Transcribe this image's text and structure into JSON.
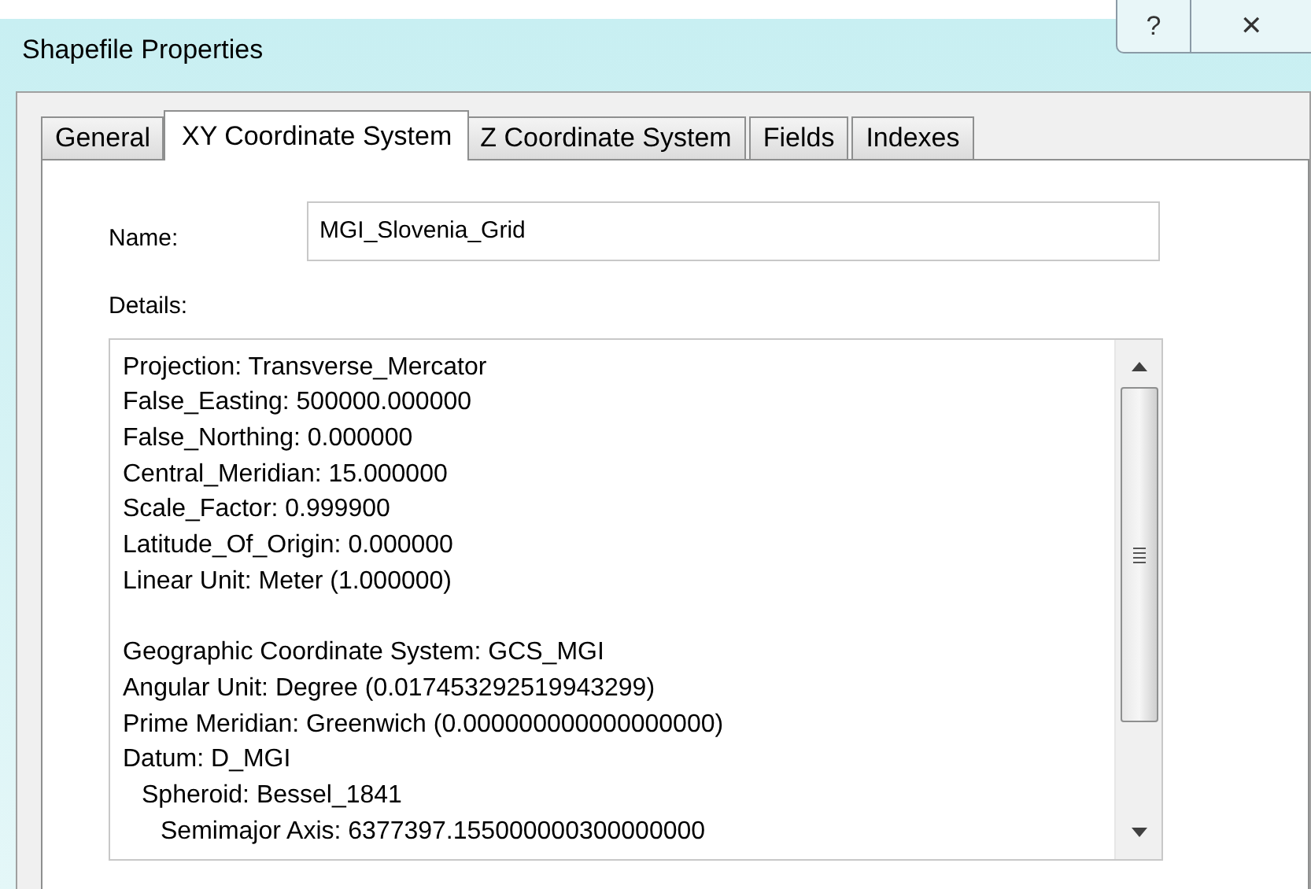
{
  "window": {
    "title": "Shapefile Properties",
    "controls": [
      "?",
      "✕"
    ]
  },
  "tabs": [
    {
      "label": "General",
      "selected": false
    },
    {
      "label": "XY Coordinate System",
      "selected": true
    },
    {
      "label": "Z Coordinate System",
      "selected": false
    },
    {
      "label": "Fields",
      "selected": false
    },
    {
      "label": "Indexes",
      "selected": false
    }
  ],
  "name": {
    "label": "Name:",
    "value": "MGI_Slovenia_Grid"
  },
  "details": {
    "label": "Details:",
    "groups": [
      {
        "lines": [
          {
            "text": "Projection: Transverse_Mercator"
          },
          {
            "text": "False_Easting: 500000.000000"
          },
          {
            "text": "False_Northing: 0.000000"
          },
          {
            "text": "Central_Meridian: 15.000000"
          },
          {
            "text": "Scale_Factor: 0.999900"
          },
          {
            "text": "Latitude_Of_Origin: 0.000000"
          },
          {
            "text": "Linear Unit: Meter (1.000000)"
          }
        ]
      },
      {
        "lines": [
          {
            "text": "Geographic Coordinate System: GCS_MGI"
          },
          {
            "text": "Angular Unit: Degree (0.017453292519943299)"
          },
          {
            "text": "Prime Meridian: Greenwich (0.000000000000000000)"
          },
          {
            "text": "Datum: D_MGI",
            "children": [
              {
                "text": "Spheroid: Bessel_1841",
                "children": [
                  {
                    "text": "Semimajor Axis: 6377397.155000000300000000"
                  }
                ]
              }
            ]
          }
        ]
      }
    ]
  }
}
